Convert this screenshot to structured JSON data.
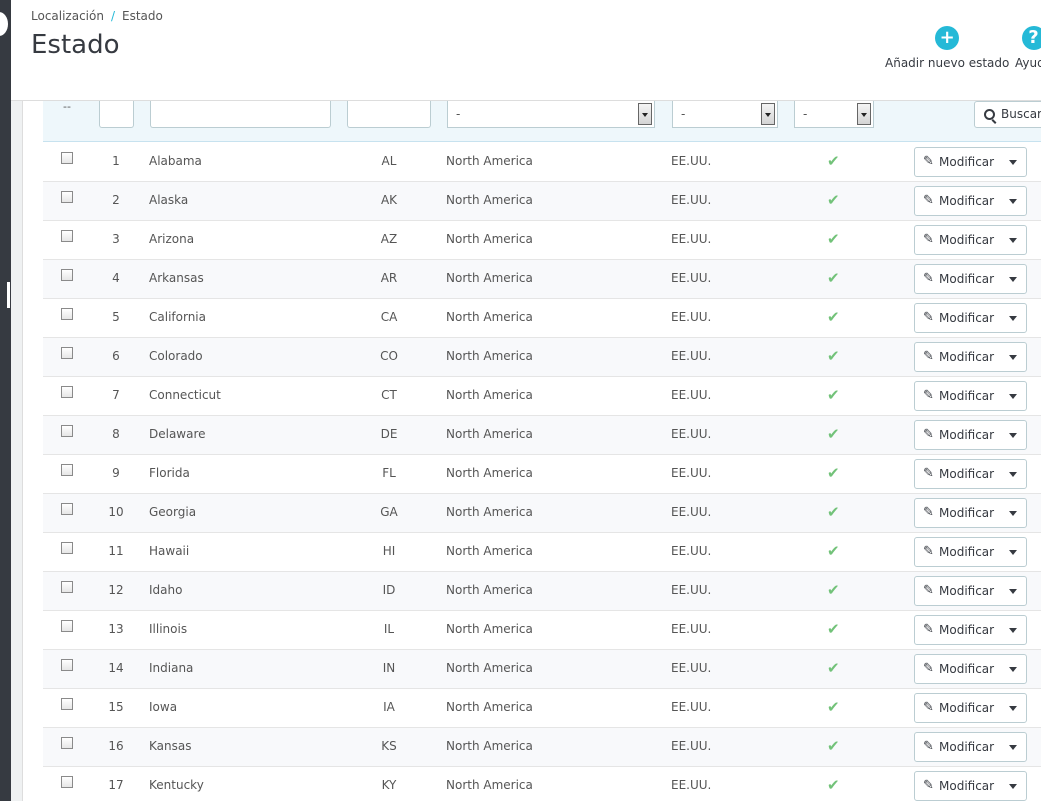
{
  "breadcrumb": {
    "parent": "Localización",
    "separator": "/",
    "current": "Estado"
  },
  "page_title": "Estado",
  "toolbar": {
    "add_label": "Añadir nuevo estado",
    "help_label": "Ayuda"
  },
  "filters": {
    "dash": "--",
    "zone_select": "-",
    "country_select": "-",
    "status_select": "-",
    "search_label": "Buscar"
  },
  "row_defaults": {
    "edit_label": "Modificar",
    "status_icon": "check-icon"
  },
  "rows": [
    {
      "id": "1",
      "name": "Alabama",
      "iso": "AL",
      "zone": "North America",
      "country": "EE.UU."
    },
    {
      "id": "2",
      "name": "Alaska",
      "iso": "AK",
      "zone": "North America",
      "country": "EE.UU."
    },
    {
      "id": "3",
      "name": "Arizona",
      "iso": "AZ",
      "zone": "North America",
      "country": "EE.UU."
    },
    {
      "id": "4",
      "name": "Arkansas",
      "iso": "AR",
      "zone": "North America",
      "country": "EE.UU."
    },
    {
      "id": "5",
      "name": "California",
      "iso": "CA",
      "zone": "North America",
      "country": "EE.UU."
    },
    {
      "id": "6",
      "name": "Colorado",
      "iso": "CO",
      "zone": "North America",
      "country": "EE.UU."
    },
    {
      "id": "7",
      "name": "Connecticut",
      "iso": "CT",
      "zone": "North America",
      "country": "EE.UU."
    },
    {
      "id": "8",
      "name": "Delaware",
      "iso": "DE",
      "zone": "North America",
      "country": "EE.UU."
    },
    {
      "id": "9",
      "name": "Florida",
      "iso": "FL",
      "zone": "North America",
      "country": "EE.UU."
    },
    {
      "id": "10",
      "name": "Georgia",
      "iso": "GA",
      "zone": "North America",
      "country": "EE.UU."
    },
    {
      "id": "11",
      "name": "Hawaii",
      "iso": "HI",
      "zone": "North America",
      "country": "EE.UU."
    },
    {
      "id": "12",
      "name": "Idaho",
      "iso": "ID",
      "zone": "North America",
      "country": "EE.UU."
    },
    {
      "id": "13",
      "name": "Illinois",
      "iso": "IL",
      "zone": "North America",
      "country": "EE.UU."
    },
    {
      "id": "14",
      "name": "Indiana",
      "iso": "IN",
      "zone": "North America",
      "country": "EE.UU."
    },
    {
      "id": "15",
      "name": "Iowa",
      "iso": "IA",
      "zone": "North America",
      "country": "EE.UU."
    },
    {
      "id": "16",
      "name": "Kansas",
      "iso": "KS",
      "zone": "North America",
      "country": "EE.UU."
    },
    {
      "id": "17",
      "name": "Kentucky",
      "iso": "KY",
      "zone": "North America",
      "country": "EE.UU."
    }
  ]
}
